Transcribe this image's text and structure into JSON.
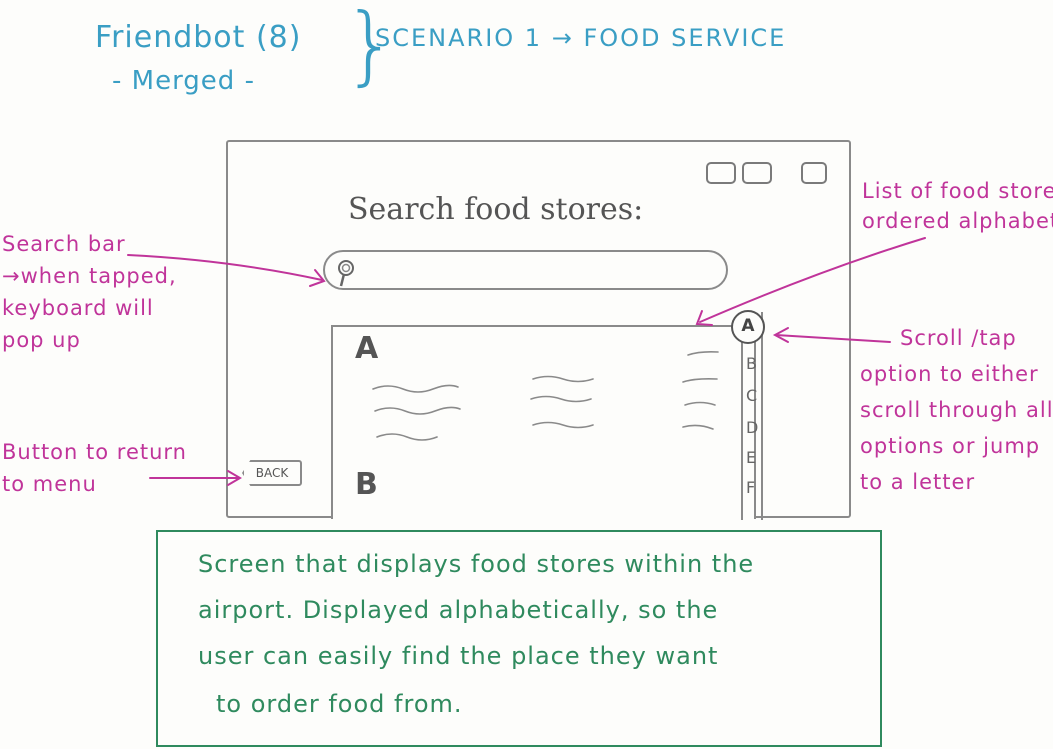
{
  "header": {
    "title": "Friendbot (8)",
    "subtitle": "- Merged -",
    "brace": "}",
    "scenario": "SCENARIO 1 → FOOD SERVICE"
  },
  "screen": {
    "title": "Search food stores:",
    "list_letters": [
      "A",
      "B"
    ],
    "az_active": "A",
    "az_letters": [
      "B",
      "C",
      "D",
      "E",
      "F"
    ],
    "back_label": "BACK"
  },
  "annotations": {
    "search_bar": [
      "Search bar",
      "→when tapped,",
      "keyboard will",
      "pop up"
    ],
    "back_button": [
      "Button to return",
      "to menu"
    ],
    "list": [
      "List of food stores",
      "ordered alphabetically"
    ],
    "scroll": [
      "Scroll /tap",
      "option to either",
      "scroll through all",
      "options or jump",
      "to a letter"
    ]
  },
  "description": [
    "Screen that displays food stores within the",
    "airport. Displayed alphabetically, so the",
    "user can easily find the place they want",
    "to order food from."
  ],
  "colors": {
    "blue_ink": "#3a9ec4",
    "pink_ink": "#c0349a",
    "green_ink": "#2f8a5e",
    "pencil": "#8a8a8a"
  }
}
